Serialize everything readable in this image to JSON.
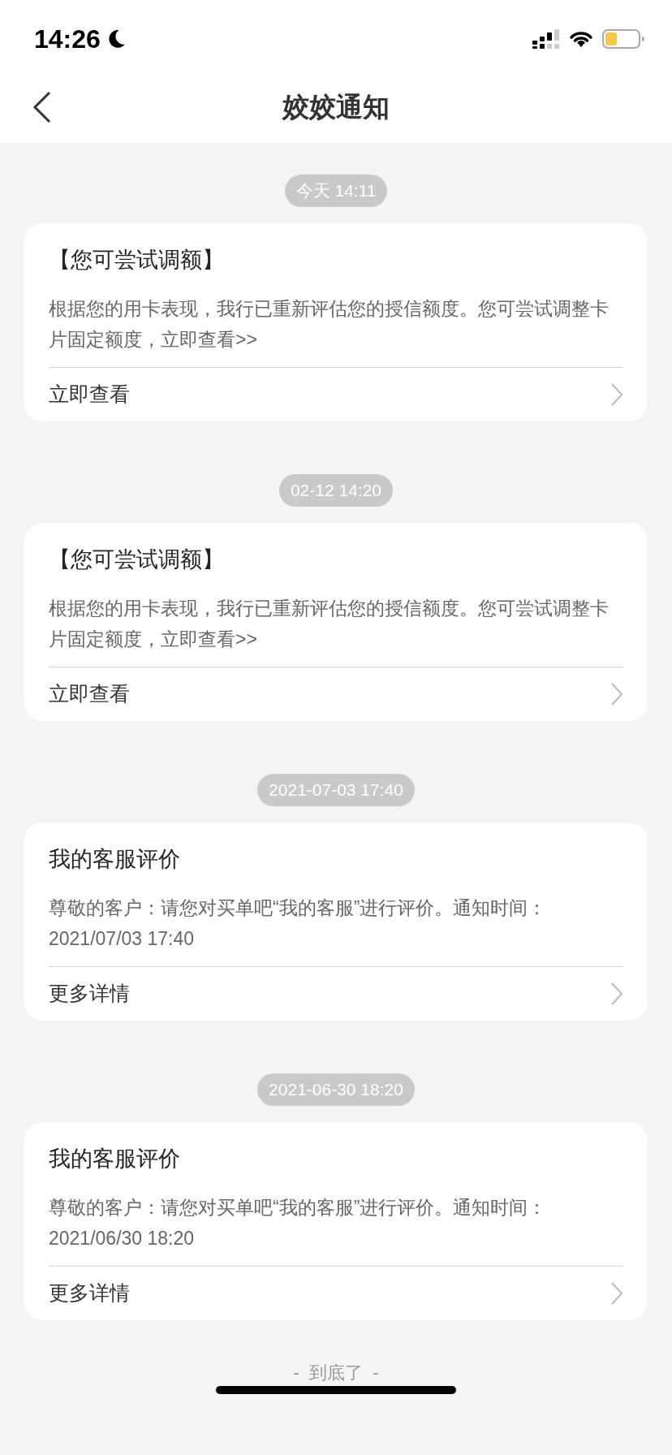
{
  "status_bar": {
    "time": "14:26"
  },
  "nav": {
    "title": "姣姣通知"
  },
  "messages": [
    {
      "timestamp": "今天 14:11",
      "title": "【您可尝试调额】",
      "body": "根据您的用卡表现，我行已重新评估您的授信额度。您可尝试调整卡片固定额度，立即查看>>",
      "action": "立即查看"
    },
    {
      "timestamp": "02-12 14:20",
      "title": "【您可尝试调额】",
      "body": "根据您的用卡表现，我行已重新评估您的授信额度。您可尝试调整卡片固定额度，立即查看>>",
      "action": "立即查看"
    },
    {
      "timestamp": "2021-07-03 17:40",
      "title": "我的客服评价",
      "body": "尊敬的客户：请您对买单吧“我的客服”进行评价。通知时间：2021/07/03 17:40",
      "action": "更多详情"
    },
    {
      "timestamp": "2021-06-30 18:20",
      "title": "我的客服评价",
      "body": "尊敬的客户：请您对买单吧“我的客服”进行评价。通知时间：2021/06/30 18:20",
      "action": "更多详情"
    }
  ],
  "footer": "-  到底了  -"
}
